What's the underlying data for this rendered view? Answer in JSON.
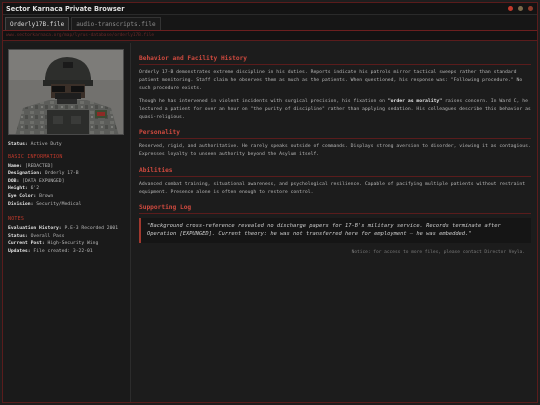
{
  "window": {
    "title": "Sector Karnaca Private Browser",
    "dots": [
      {
        "name": "minimize",
        "color": "#c0392b"
      },
      {
        "name": "maximize",
        "color": "#7a6a4a"
      },
      {
        "name": "close",
        "color": "#8e3a2a"
      }
    ]
  },
  "tabs": [
    {
      "label": "Orderly17B.file",
      "active": true
    },
    {
      "label": "audio-transcripts.file",
      "active": false
    }
  ],
  "url": "www.sectorkarnaca.org/map/lyrus-database/orderly17B.file",
  "sidebar": {
    "status_label": "Status:",
    "status_value": "Active Duty",
    "basic_info_header": "BASIC INFORMATION",
    "basic_info": [
      {
        "label": "Name:",
        "value": "[REDACTED]"
      },
      {
        "label": "Designation:",
        "value": "Orderly 17-B"
      },
      {
        "label": "DOB:",
        "value": "[DATA EXPUNGED]"
      },
      {
        "label": "Height:",
        "value": "6'2"
      },
      {
        "label": "Eye Color:",
        "value": "Brown"
      },
      {
        "label": "Division:",
        "value": "Security/Medical"
      }
    ],
    "notes_header": "NOTES",
    "notes": [
      {
        "label": "Evaluation History:",
        "value": "P.E-3 Recorded 2001"
      },
      {
        "label": "Status:",
        "value": "Overall Pass"
      },
      {
        "label": "Current Post:",
        "value": "High-Security Wing"
      },
      {
        "label": "Updates:",
        "value": "File created: 3-22-01"
      }
    ]
  },
  "main": {
    "sections": [
      {
        "title": "Behavior and Facility History",
        "paragraphs": [
          {
            "parts": [
              {
                "text": "Orderly 17-B demonstrates extreme discipline in his duties. Reports indicate his patrols mirror tactical sweeps rather than standard patient monitoring. Staff claim he observes them as much as the patients. When questioned, his response was: \"Following procedure.\" No such procedure exists.",
                "bold": false
              }
            ]
          },
          {
            "parts": [
              {
                "text": "Though he has intervened in violent incidents with surgical precision, his fixation on ",
                "bold": false
              },
              {
                "text": "\"order as morality\"",
                "bold": true
              },
              {
                "text": " raises concern. In Ward C, he lectured a patient for over an hour on \"the purity of discipline\" rather than applying sedation. His colleagues describe this behavior as quasi-religious.",
                "bold": false
              }
            ]
          }
        ]
      },
      {
        "title": "Personality",
        "paragraphs": [
          {
            "parts": [
              {
                "text": "Reserved, rigid, and authoritative. He rarely speaks outside of commands. Displays strong aversion to disorder, viewing it as contagious. Expresses loyalty to unseen authority beyond the Asylum itself.",
                "bold": false
              }
            ]
          }
        ]
      },
      {
        "title": "Abilities",
        "paragraphs": [
          {
            "parts": [
              {
                "text": "Advanced combat training, situational awareness, and psychological resilience. Capable of pacifying multiple patients without restraint equipment. Presence alone is often enough to restore control.",
                "bold": false
              }
            ]
          }
        ]
      },
      {
        "title": "Supporting Log",
        "quote": "\"Background cross-reference revealed no discharge papers for 17-B's military service. Records terminate after Operation [EXPUNGED]. Current theory: he was not transferred here for employment — he was embedded.\""
      }
    ],
    "notice": "Notice: for access to more files, please contact Director Veyla."
  },
  "colors": {
    "accent": "#c0392b",
    "border": "#5a1c1c",
    "background": "#1c1c1c"
  }
}
